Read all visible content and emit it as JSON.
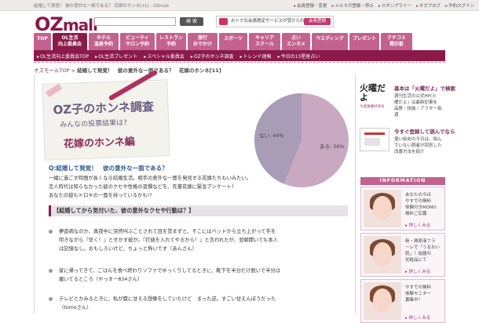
{
  "top": {
    "tagline": "結婚して発覚！ 彼の意外な一面である？ 花嫁のホンネ[11] - OZmall",
    "links": [
      "会員登録・変更",
      "メルマガ登録・停止",
      "スタンプラリー",
      "オズブログ",
      "予約ログイン"
    ]
  },
  "header": {
    "logo_a": "OZ",
    "logo_b": "mall",
    "search_button": "検 索",
    "member_promo": "おトクな会員限定サービスが受けられる",
    "register_button": "会員登録"
  },
  "nav": {
    "items": [
      {
        "label": "TOP",
        "active": false
      },
      {
        "label": "OL生活\n向上委員会",
        "active": true
      },
      {
        "label": "ホテル\n温泉予約",
        "active": false
      },
      {
        "label": "ビューティ\nサロン予約",
        "active": false
      },
      {
        "label": "レストラン\n予約",
        "active": false
      },
      {
        "label": "旅行\nおでかけ",
        "active": false
      },
      {
        "label": "スポーツ",
        "active": false
      },
      {
        "label": "キャリア\nスクール",
        "active": false
      },
      {
        "label": "占い\nエンタメ",
        "active": false
      },
      {
        "label": "ウエディング",
        "active": false
      },
      {
        "label": "プレゼント",
        "active": false
      },
      {
        "label": "クチコミ\n掲示板",
        "active": false
      }
    ],
    "sub_items": [
      "OL生活向上委員会TOP",
      "OL生活プレゼント",
      "スペシャル委員会",
      "OZ子のホンネ調査",
      "トレンド速報",
      "今日の13星座占い"
    ]
  },
  "breadcrumb": {
    "home": "オズモールTOP",
    "sep": " > ",
    "current": "結婚して発覚！　彼の意外な一面である？　花嫁のホンネ[11]"
  },
  "title_art": {
    "line1": "OZ子のホンネ調査",
    "line2": "みんなの投票結果は?",
    "line3": "花嫁のホンネ編"
  },
  "chart_data": {
    "type": "pie",
    "slices": [
      {
        "label": "ある",
        "value": 56,
        "display": "ある: 56%",
        "color": "#c9a9c2"
      },
      {
        "label": "ない",
        "value": 44,
        "display": "ない: 44%",
        "color": "#a99cb6"
      }
    ]
  },
  "question": "Q:結婚して発覚！　彼の意外な一面である？",
  "intro": [
    "一緒に過ごす時間が長くなる結婚生活。相手の意外な一面を発見する花嫁たちもいみたい。",
    "恋人時代は知らなかった彼のクセや性格の習慣などを、先輩花嫁に緊急アンケート！",
    "あなたの彼もドロキの一面を持っているかも!?"
  ],
  "section_title": "【結婚してから気付いた、彼の意外なクセや行動は？】",
  "answers": [
    {
      "lines": [
        "夢遊病なのか、真夜中に突然叫ぶことされて目を覚まずと、そこにはベッドから立ち上がって手を",
        "叩きながら『早く！』とせかす彼が。『打値を入れてやるから！』と言われたが、翌朝聞いても本人",
        "は記憶なし。おもしろいけど、ちょっと怖いです（あんさん）"
      ]
    },
    {
      "lines": [
        "家に帰ってきて、ごはんを食べ終わりソファでゆっくりしてるときに、靴下を半分だけ脱いで半分は",
        "履いてるところ（やっすー834さん）"
      ]
    },
    {
      "lines": [
        "テレビとかみるときに、私が膝に甘える想像をしていたけど　まった逆。すごい甘えんぼうだった",
        "（tomoさん）"
      ]
    }
  ],
  "sidebar": {
    "weekly_badge": "火曜だよ",
    "weekly_badge_sub": "今週金曜好評号",
    "weekly_title": "基本は「火曜だよ」で検索",
    "weekly_desc": [
      "週刊生活の公式HP(火",
      "曜だよ」は最新記事を",
      "品質・技能・アフター毎",
      "週"
    ],
    "bookmark_title": "今すぐ登録して読んでなら",
    "bookmark_desc": [
      "使い始めの今日は、悩ん",
      "でいない読者が回答した",
      "改善方法を紹介"
    ],
    "info_header": "INFORMATION",
    "info_items": [
      {
        "lines": [
          "あなたの今ほ",
          "やすでの無料",
          "体験付きMONO",
          "無料ご応募"
        ],
        "cta": "詳しくみる"
      },
      {
        "lines": [
          "新・潤原液フラ",
          "ーレで「うるおい",
          "肌」！話題の",
          "化粧品にて"
        ],
        "cta": "詳しくみる"
      },
      {
        "lines": [
          "やすでの無料",
          "体験モニター",
          "募集中！"
        ],
        "cta": "詳しくみる"
      }
    ]
  }
}
